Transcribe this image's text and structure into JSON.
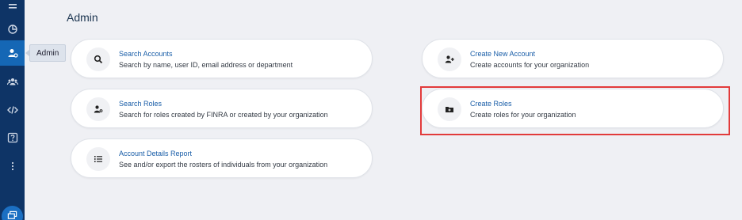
{
  "tooltip": "Admin",
  "page_title": "Admin",
  "cards": {
    "search_accounts": {
      "title": "Search Accounts",
      "desc": "Search by name, user ID, email address or department"
    },
    "create_account": {
      "title": "Create New Account",
      "desc": "Create accounts for your organization"
    },
    "search_roles": {
      "title": "Search Roles",
      "desc": "Search for roles created by FINRA or created by your organization"
    },
    "create_roles": {
      "title": "Create Roles",
      "desc": "Create roles for your organization"
    },
    "account_details": {
      "title": "Account Details Report",
      "desc": "See and/or export the rosters of individuals from your organization"
    }
  },
  "colors": {
    "sidebar": "#0e3466",
    "sidebar_active": "#1567b5",
    "link": "#1a5ea8",
    "highlight": "#e23b3b",
    "background": "#eff0f4"
  }
}
